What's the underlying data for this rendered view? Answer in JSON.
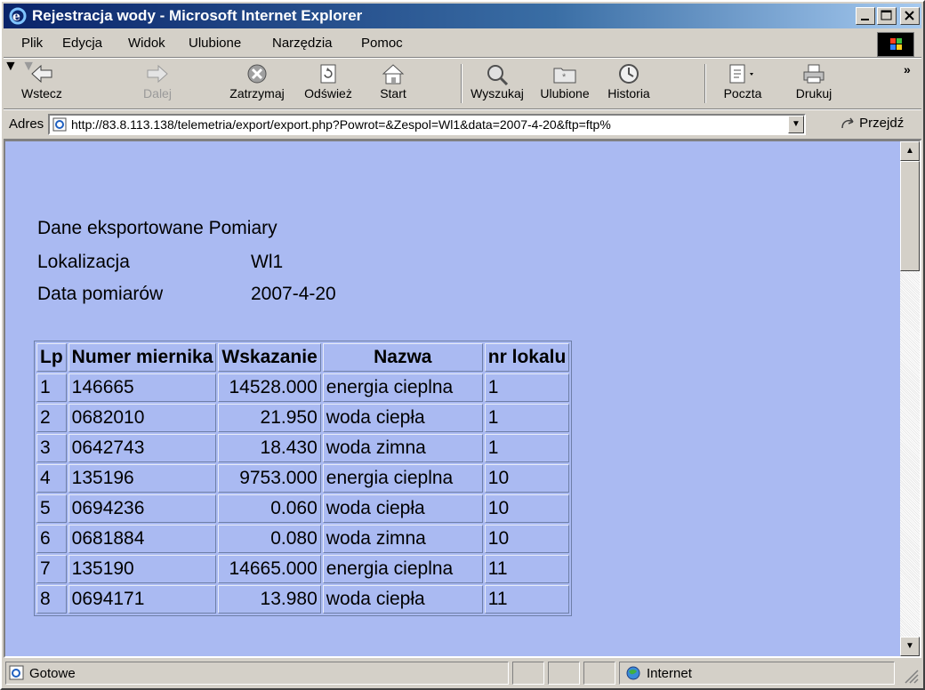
{
  "window": {
    "title": "Rejestracja wody - Microsoft Internet Explorer"
  },
  "menu": [
    "Plik",
    "Edycja",
    "Widok",
    "Ulubione",
    "Narzędzia",
    "Pomoc"
  ],
  "toolbar": {
    "back": "Wstecz",
    "forward": "Dalej",
    "stop": "Zatrzymaj",
    "refresh": "Odśwież",
    "home": "Start",
    "search": "Wyszukaj",
    "favorites": "Ulubione",
    "history": "Historia",
    "mail": "Poczta",
    "print": "Drukuj",
    "more": "»"
  },
  "address": {
    "label": "Adres",
    "url": "http://83.8.113.138/telemetria/export/export.php?Powrot=&Zespol=Wl1&data=2007-4-20&ftp=ftp%",
    "go": "Przejdź"
  },
  "content": {
    "heading": "Dane eksportowane Pomiary",
    "location_label": "Lokalizacja",
    "location_value": "Wl1",
    "date_label": "Data pomiarów",
    "date_value": "2007-4-20"
  },
  "table": {
    "headers": [
      "Lp",
      "Numer miernika",
      "Wskazanie",
      "Nazwa",
      "nr lokalu"
    ],
    "rows": [
      [
        "1",
        "146665",
        "14528.000",
        "energia cieplna",
        "1"
      ],
      [
        "2",
        "0682010",
        "21.950",
        "woda ciepła",
        "1"
      ],
      [
        "3",
        "0642743",
        "18.430",
        "woda zimna",
        "1"
      ],
      [
        "4",
        "135196",
        "9753.000",
        "energia cieplna",
        "10"
      ],
      [
        "5",
        "0694236",
        "0.060",
        "woda ciepła",
        "10"
      ],
      [
        "6",
        "0681884",
        "0.080",
        "woda zimna",
        "10"
      ],
      [
        "7",
        "135190",
        "14665.000",
        "energia cieplna",
        "11"
      ],
      [
        "8",
        "0694171",
        "13.980",
        "woda ciepła",
        "11"
      ]
    ]
  },
  "status": {
    "text": "Gotowe",
    "zone": "Internet"
  },
  "colors": {
    "page_background": "#aabaf2",
    "titlebar": "#0a246a"
  }
}
